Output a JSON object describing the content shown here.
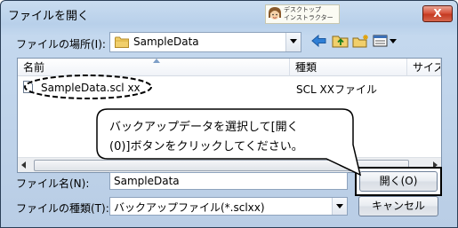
{
  "window": {
    "title": "ファイルを開く",
    "close_label": "X"
  },
  "logo": {
    "line1": "デスクトップ",
    "line2": "インストラクター"
  },
  "location": {
    "label": "ファイルの場所(I):",
    "value": "SampleData"
  },
  "columns": {
    "name": "名前",
    "type": "種類",
    "size": "サイズ"
  },
  "files": [
    {
      "name": "SampleData.scl xx",
      "type": "SCL XXファイル"
    }
  ],
  "callout": {
    "line1": "バックアップデータを選択して[開く",
    "line2": "(0)]ボタンをクリックしてください。"
  },
  "filename": {
    "label": "ファイル名(N):",
    "value": "SampleData"
  },
  "filetype": {
    "label": "ファイルの種類(T):",
    "value": "バックアップファイル(*.sclxx)"
  },
  "buttons": {
    "open": "開く(O)",
    "cancel": "キャンセル"
  },
  "colors": {
    "accent": "#2b3f57",
    "close": "#c43a22"
  },
  "icons": [
    "folder-icon",
    "back-arrow-icon",
    "up-folder-icon",
    "new-folder-icon",
    "view-menu-icon",
    "document-icon"
  ]
}
